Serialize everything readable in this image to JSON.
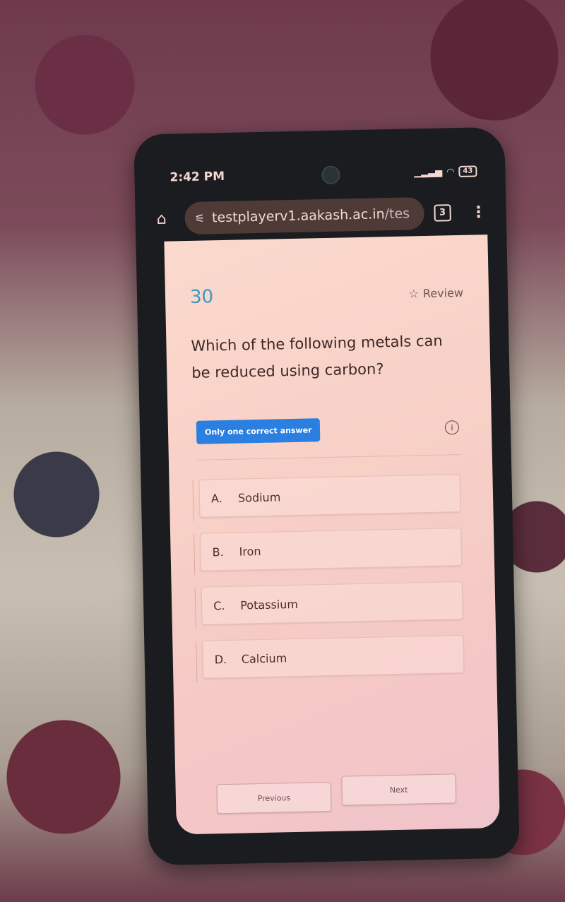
{
  "statusbar": {
    "time": "2:42 PM",
    "battery": "43"
  },
  "browser": {
    "url_host": "testplayerv1.aakash.ac.in",
    "url_path": "/tes",
    "tab_count": "3"
  },
  "question": {
    "number": "30",
    "review_label": "Review",
    "text": "Which of the following metals can be reduced using carbon?",
    "type_badge": "Only one correct answer",
    "options": [
      {
        "letter": "A.",
        "text": "Sodium"
      },
      {
        "letter": "B.",
        "text": "Iron"
      },
      {
        "letter": "C.",
        "text": "Potassium"
      },
      {
        "letter": "D.",
        "text": "Calcium"
      }
    ]
  },
  "navigation": {
    "previous_label": "Previous",
    "next_label": "Next"
  },
  "colors": {
    "accent_blue": "#2a7fe0",
    "question_number": "#3b9ac0"
  }
}
